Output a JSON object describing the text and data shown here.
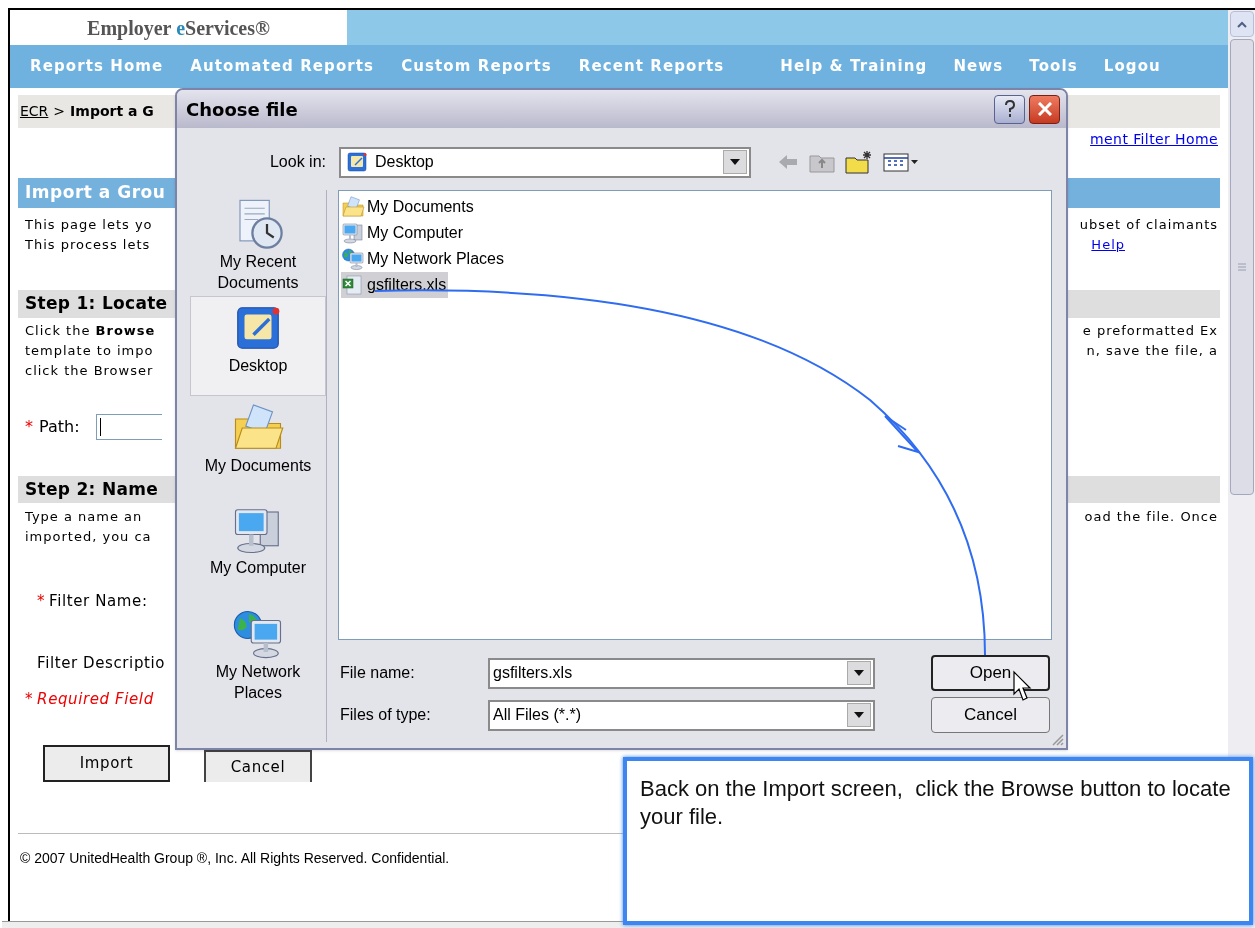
{
  "header": {
    "logo": [
      {
        "text": "Employer ",
        "accent": false
      },
      {
        "text": "e",
        "accent": true
      },
      {
        "text": "Services®",
        "accent": false
      }
    ]
  },
  "nav_left": [
    "Reports Home",
    "Automated Reports",
    "Custom Reports",
    "Recent Reports"
  ],
  "nav_right": [
    "Help & Training",
    "News",
    "Tools",
    "Logou"
  ],
  "breadcrumb": {
    "link": "ECR",
    "separator": ">",
    "current": "Import a G"
  },
  "top_link": "ment Filter Home",
  "intro": {
    "title": "Import a Grou",
    "lines": [
      {
        "left": "This page lets yo",
        "right": "ubset of claimants",
        "kind": "text"
      },
      {
        "left": "This process lets",
        "right": "Help",
        "kind": "link"
      }
    ]
  },
  "step1": {
    "title": "Step 1: Locate",
    "lines": [
      {
        "left": "Click the **Browse**",
        "right": "e preformatted Ex"
      },
      {
        "left": "template to impo",
        "right": "n, save the file, a"
      },
      {
        "left": "click the Browser"
      }
    ],
    "path": {
      "mark": "*",
      "label": "Path:"
    }
  },
  "step2": {
    "title": "Step 2: Name",
    "lines": [
      {
        "left": "Type a name an",
        "right": "oad the file. Once"
      },
      {
        "left": "imported, you ca"
      }
    ],
    "fields": [
      {
        "mark": "*",
        "label": "Filter Name:"
      },
      {
        "label": "Filter Descriptio"
      }
    ],
    "required_note": {
      "mark": "*",
      "text": "Required Field"
    }
  },
  "buttons": [
    "Import",
    "Cancel"
  ],
  "footer": "© 2007 UnitedHealth Group ®, Inc. All Rights Reserved. Confidential.",
  "dialog": {
    "title": "Choose file",
    "look_in": {
      "label": "Look in:",
      "value": "Desktop"
    },
    "places": [
      {
        "label": "My Recent Documents",
        "kind": "recent",
        "selected": false
      },
      {
        "label": "Desktop",
        "kind": "desktop",
        "selected": true
      },
      {
        "label": "My Documents",
        "kind": "documents",
        "selected": false
      },
      {
        "label": "My Computer",
        "kind": "computer",
        "selected": false
      },
      {
        "label": "My Network Places",
        "kind": "network",
        "selected": false
      }
    ],
    "files": [
      {
        "name": "My Documents",
        "kind": "documents",
        "selected": false
      },
      {
        "name": "My Computer",
        "kind": "computer",
        "selected": false
      },
      {
        "name": "My Network Places",
        "kind": "network",
        "selected": false
      },
      {
        "name": "gsfilters.xls",
        "kind": "spreadsheet",
        "selected": true
      }
    ],
    "file_name": {
      "label": "File name:",
      "value": "gsfilters.xls"
    },
    "file_type": {
      "label": "Files of type:",
      "value": "All Files (*.*)"
    },
    "buttons": [
      "Open",
      "Cancel"
    ]
  },
  "callout": {
    "text": "Back on the Import screen,  click the Browse button to locate your file."
  }
}
